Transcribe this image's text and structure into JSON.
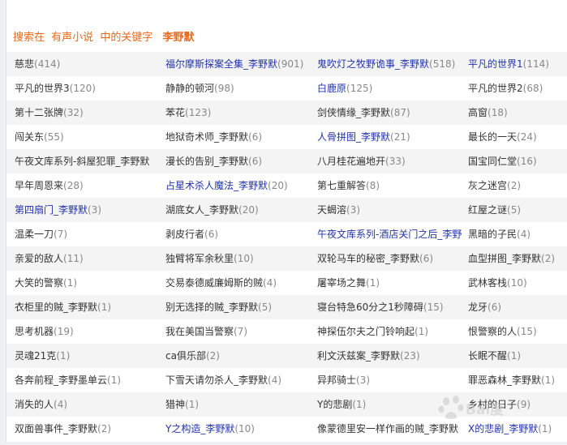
{
  "header": {
    "prefix": "搜索在",
    "category": "有声小说",
    "middle": "中的关键字",
    "keyword": "李野默"
  },
  "rows": [
    [
      {
        "title": "慈悲",
        "count": "(414)",
        "link": false
      },
      {
        "title": "福尔摩斯探案全集_李野默",
        "count": "(901)",
        "link": true
      },
      {
        "title": "鬼吹灯之牧野诡事_李野默",
        "count": "(518)",
        "link": true
      },
      {
        "title": "平凡的世界1",
        "count": "(114)",
        "link": true
      }
    ],
    [
      {
        "title": "平凡的世界3",
        "count": "(120)",
        "link": false
      },
      {
        "title": "静静的顿河",
        "count": "(98)",
        "link": false
      },
      {
        "title": "白鹿原",
        "count": "(125)",
        "link": true
      },
      {
        "title": "平凡的世界2",
        "count": "(68)",
        "link": false
      }
    ],
    [
      {
        "title": "第十二张牌",
        "count": "(32)",
        "link": false
      },
      {
        "title": "苯花",
        "count": "(123)",
        "link": false
      },
      {
        "title": "剑侠情缘_李野默",
        "count": "(87)",
        "link": false
      },
      {
        "title": "高窗",
        "count": "(18)",
        "link": false
      }
    ],
    [
      {
        "title": "闯关东",
        "count": "(55)",
        "link": false
      },
      {
        "title": "地狱奇术师_李野默",
        "count": "(6)",
        "link": false
      },
      {
        "title": "人骨拼图_李野默",
        "count": "(21)",
        "link": true
      },
      {
        "title": "最长的一天",
        "count": "(24)",
        "link": false
      }
    ],
    [
      {
        "title": "午夜文库系列-斜屋犯罪_李野默",
        "count": "",
        "link": false
      },
      {
        "title": "漫长的告别_李野默",
        "count": "(6)",
        "link": false
      },
      {
        "title": "八月桂花遍地开",
        "count": "(33)",
        "link": false
      },
      {
        "title": "国宝同仁堂",
        "count": "(16)",
        "link": false
      }
    ],
    [
      {
        "title": "早年周恩来",
        "count": "(28)",
        "link": false
      },
      {
        "title": "占星术杀人魔法_李野默",
        "count": "(20)",
        "link": true
      },
      {
        "title": "第七重解答",
        "count": "(8)",
        "link": false
      },
      {
        "title": "灰之迷宫",
        "count": "(2)",
        "link": false
      }
    ],
    [
      {
        "title": "第四扇门_李野默",
        "count": "(3)",
        "link": true
      },
      {
        "title": "湖底女人_李野默",
        "count": "(20)",
        "link": false
      },
      {
        "title": "天蝎溶",
        "count": "(3)",
        "link": false
      },
      {
        "title": "红屋之谜",
        "count": "(5)",
        "link": false
      }
    ],
    [
      {
        "title": "温柔一刀",
        "count": "(7)",
        "link": false
      },
      {
        "title": "剥皮行者",
        "count": "(6)",
        "link": false
      },
      {
        "title": "午夜文库系列-酒店关门之后_李野",
        "count": "",
        "link": true
      },
      {
        "title": "黑暗的子民",
        "count": "(4)",
        "link": false
      }
    ],
    [
      {
        "title": "亲爱的敌人",
        "count": "(11)",
        "link": false
      },
      {
        "title": "独臂将军余秋里",
        "count": "(10)",
        "link": false
      },
      {
        "title": "双轮马车的秘密_李野默",
        "count": "(6)",
        "link": false
      },
      {
        "title": "血型拼图_李野默",
        "count": "(2)",
        "link": false
      }
    ],
    [
      {
        "title": "大笑的警察",
        "count": "(1)",
        "link": false
      },
      {
        "title": "交易泰德威廉姆斯的贼",
        "count": "(4)",
        "link": false
      },
      {
        "title": "屠宰场之舞",
        "count": "(1)",
        "link": false
      },
      {
        "title": "武林客栈",
        "count": "(10)",
        "link": false
      }
    ],
    [
      {
        "title": "衣柜里的贼_李野默",
        "count": "(1)",
        "link": false
      },
      {
        "title": "别无选择的贼_李野默",
        "count": "(5)",
        "link": false
      },
      {
        "title": "寝台特急60分之1秒障碍",
        "count": "(15)",
        "link": false
      },
      {
        "title": "龙牙",
        "count": "(6)",
        "link": false
      }
    ],
    [
      {
        "title": "思考机器",
        "count": "(19)",
        "link": false
      },
      {
        "title": "我在美国当警察",
        "count": "(7)",
        "link": false
      },
      {
        "title": "神探伍尔夫之门铃响起",
        "count": "(1)",
        "link": false
      },
      {
        "title": "恨警察的人",
        "count": "(15)",
        "link": false
      }
    ],
    [
      {
        "title": "灵魂21克",
        "count": "(1)",
        "link": false
      },
      {
        "title": "ca俱乐部",
        "count": "(2)",
        "link": false
      },
      {
        "title": "利文沃兹案_李野默",
        "count": "(23)",
        "link": false
      },
      {
        "title": "长眠不醒",
        "count": "(1)",
        "link": false
      }
    ],
    [
      {
        "title": "各奔前程_李野墨单云",
        "count": "(1)",
        "link": false
      },
      {
        "title": "下雪天请勿杀人_李野默",
        "count": "(4)",
        "link": false
      },
      {
        "title": "异邦骑士",
        "count": "(3)",
        "link": false
      },
      {
        "title": "罪恶森林_李野默",
        "count": "(1)",
        "link": false
      }
    ],
    [
      {
        "title": "消失的人",
        "count": "(4)",
        "link": false
      },
      {
        "title": "猎神",
        "count": "(1)",
        "link": false
      },
      {
        "title": "Y的悲剧",
        "count": "(1)",
        "link": false
      },
      {
        "title": "乡村的日子",
        "count": "(9)",
        "link": false
      }
    ],
    [
      {
        "title": "双面兽事件_李野默",
        "count": "(2)",
        "link": false
      },
      {
        "title": "Y之构造_李野默",
        "count": "(10)",
        "link": true
      },
      {
        "title": "像蒙德里安一样作画的贼_李野默",
        "count": "",
        "link": false
      },
      {
        "title": "X的悲剧_李野默",
        "count": "(1)",
        "link": true
      }
    ]
  ],
  "watermark": {
    "text": "Bai度"
  }
}
